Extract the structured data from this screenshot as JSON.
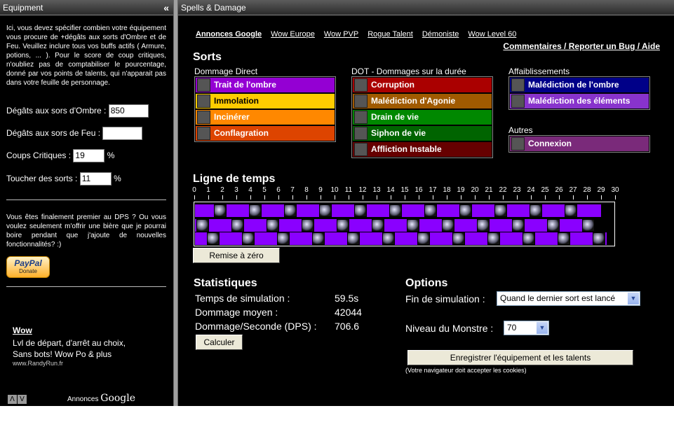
{
  "left_panel": {
    "title": "Equipment",
    "collapse": "«",
    "intro": "Ici, vous devez spécifier combien votre équipement vous procure de +dégâts aux sorts d'Ombre et de Feu. Veuillez inclure tous vos buffs actifs ( Armure, potions, ... ). Pour le score de coup critiques, n'oubliez pas de comptabiliser le pourcentage, donné par vos points de talents, qui n'apparait pas dans votre feuille de personnage.",
    "fields": {
      "shadow_label": "Dégâts aux sors d'Ombre :",
      "shadow_value": "850",
      "fire_label": "Dégâts aux sors de Feu :",
      "fire_value": "",
      "crit_label": "Coups Critiques :",
      "crit_value": "19",
      "hit_label": "Toucher des sorts :",
      "hit_value": "11",
      "percent": "%"
    },
    "dps_text": "Vous êtes finalement premier au DPS ? Ou vous voulez seulement m'offrir une bière que je pourrai boire pendant que j'ajoute de nouvelles fonctionnalités? :)",
    "paypal": {
      "brand": "PayPal",
      "action": "Donate"
    },
    "ad": {
      "title": "Wow",
      "line1": "Lvl de départ, d'arrêt au choix,",
      "line2": "Sans bots! Wow Po & plus",
      "url": "www.RandyRun.fr",
      "nav_prev": "Λ",
      "nav_next": "V",
      "annonces": "Annonces",
      "google": "Google"
    }
  },
  "main": {
    "title": "Spells & Damage",
    "links": [
      "Annonces Google",
      "Wow Europe",
      "Wow PVP",
      "Rogue Talent",
      "Démoniste",
      "Wow Level 60"
    ],
    "comments": "Commentaires / Reporter un Bug / Aide",
    "sorts_title": "Sorts",
    "groups": {
      "direct": {
        "label": "Dommage Direct",
        "spells": [
          {
            "name": "Trait de l'ombre",
            "bg": "#9400d3",
            "fg": "#ffffff"
          },
          {
            "name": "Immolation",
            "bg": "#ffcc00",
            "fg": "#000000"
          },
          {
            "name": "Incinérer",
            "bg": "#ff8800",
            "fg": "#ffffff"
          },
          {
            "name": "Conflagration",
            "bg": "#dd4400",
            "fg": "#ffffff"
          }
        ]
      },
      "dot": {
        "label": "DOT - Dommages sur la durée",
        "spells": [
          {
            "name": "Corruption",
            "bg": "#aa0000",
            "fg": "#ffffff"
          },
          {
            "name": "Malédiction d'Agonie",
            "bg": "#a05a00",
            "fg": "#ffffff"
          },
          {
            "name": "Drain de vie",
            "bg": "#008800",
            "fg": "#ffffff"
          },
          {
            "name": "Siphon de vie",
            "bg": "#006400",
            "fg": "#ffffff"
          },
          {
            "name": "Affliction Instable",
            "bg": "#660000",
            "fg": "#ffffff"
          }
        ]
      },
      "affli": {
        "label": "Affaiblissements",
        "spells": [
          {
            "name": "Malédiction de l'ombre",
            "bg": "#000088",
            "fg": "#ffffff"
          },
          {
            "name": "Malédiction des éléments",
            "bg": "#8833cc",
            "fg": "#ffffff"
          }
        ]
      },
      "autres": {
        "label": "Autres",
        "spells": [
          {
            "name": "Connexion",
            "bg": "#7a2a7a",
            "fg": "#ffffff"
          }
        ]
      }
    },
    "timeline_title": "Ligne de temps",
    "ruler": [
      "0",
      "1",
      "2",
      "3",
      "4",
      "5",
      "6",
      "7",
      "8",
      "9",
      "10",
      "11",
      "12",
      "13",
      "14",
      "15",
      "16",
      "17",
      "18",
      "19",
      "20",
      "21",
      "22",
      "23",
      "24",
      "25",
      "26",
      "27",
      "28",
      "29",
      "30"
    ],
    "reset_button": "Remise à zéro",
    "stats": {
      "title": "Statistiques",
      "sim_time_label": "Temps de simulation :",
      "sim_time_value": "59.5s",
      "avg_dmg_label": "Dommage moyen :",
      "avg_dmg_value": "42044",
      "dps_label": "Dommage/Seconde (DPS) :",
      "dps_value": "706.6",
      "calc_button": "Calculer"
    },
    "options": {
      "title": "Options",
      "end_label": "Fin de simulation :",
      "end_value": "Quand le dernier sort est lancé",
      "level_label": "Niveau du Monstre :",
      "level_value": "70",
      "save_button": "Enregistrer l'équipement et les talents",
      "note": "(Votre navigateur doit accepter les cookies)"
    }
  },
  "colors": {
    "timeline_purple": "#8a00ff",
    "timeline_dark": "#9b1f9b"
  }
}
